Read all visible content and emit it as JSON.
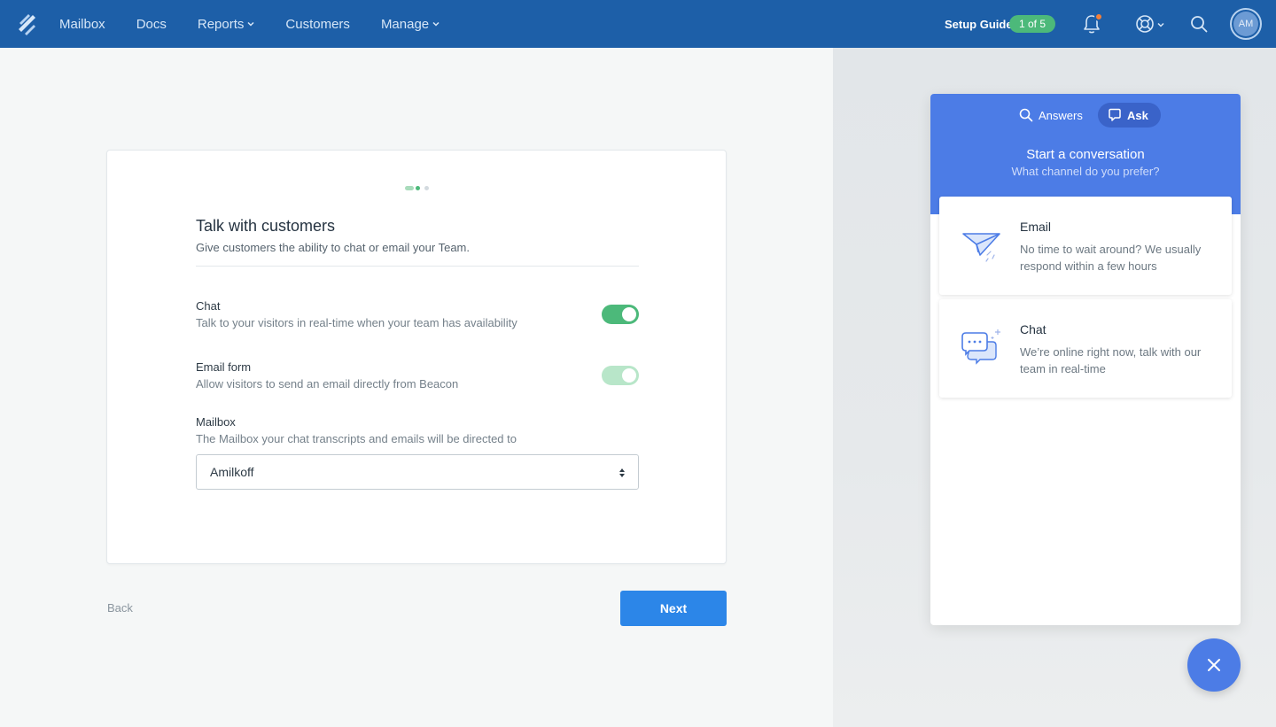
{
  "nav": {
    "logo_icon": "helpscout-logo-icon",
    "items": [
      {
        "label": "Mailbox",
        "has_dropdown": false
      },
      {
        "label": "Docs",
        "has_dropdown": false
      },
      {
        "label": "Reports",
        "has_dropdown": true
      },
      {
        "label": "Customers",
        "has_dropdown": false
      },
      {
        "label": "Manage",
        "has_dropdown": true
      }
    ],
    "setup_guide_label": "Setup Guide",
    "setup_guide_badge": "1 of 5",
    "avatar_initials": "AM"
  },
  "card": {
    "title": "Talk with customers",
    "subtitle": "Give customers the ability to chat or email your Team.",
    "options": [
      {
        "title": "Chat",
        "description": "Talk to your visitors in real-time when your team has availability",
        "enabled": true
      },
      {
        "title": "Email form",
        "description": "Allow visitors to send an email directly from Beacon",
        "enabled": true
      }
    ],
    "mailbox": {
      "title": "Mailbox",
      "description": "The Mailbox your chat transcripts and emails will be directed to",
      "selected": "Amilkoff"
    }
  },
  "footer": {
    "back_label": "Back",
    "next_label": "Next"
  },
  "beacon": {
    "tabs": [
      {
        "label": "Answers",
        "icon": "search-icon",
        "active": false
      },
      {
        "label": "Ask",
        "icon": "chat-bubble-icon",
        "active": true
      }
    ],
    "title": "Start a conversation",
    "subtitle": "What channel do you prefer?",
    "channels": [
      {
        "title": "Email",
        "description": "No time to wait around? We usually respond within a few hours",
        "icon": "paper-plane-icon"
      },
      {
        "title": "Chat",
        "description": "We’re online right now, talk with our team in real-time",
        "icon": "chat-bubbles-icon"
      }
    ]
  },
  "colors": {
    "nav_bg": "#1d5fa8",
    "accent_green": "#4cb97a",
    "beacon_blue": "#4c7ce6",
    "button_blue": "#2c86e8"
  }
}
